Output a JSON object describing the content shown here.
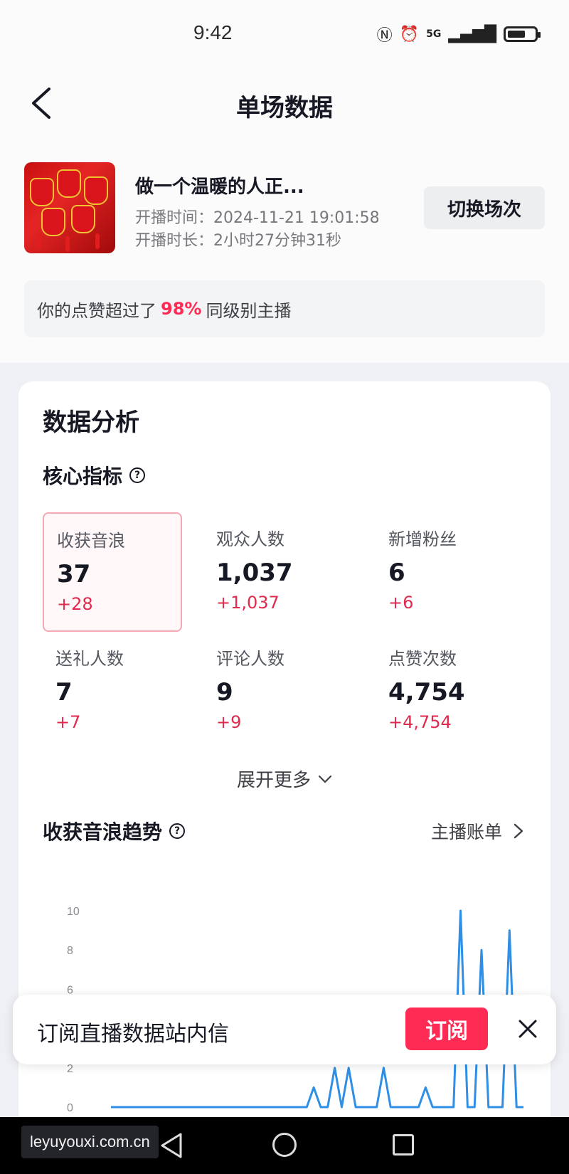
{
  "status_bar": {
    "time": "9:42",
    "network": "5G",
    "icons": [
      "nfc-icon",
      "alarm-icon",
      "signal-icon",
      "battery-icon"
    ]
  },
  "header": {
    "title": "单场数据",
    "back_icon": "chevron-left-icon"
  },
  "session": {
    "title": "做一个温暖的人正...",
    "start_time": "开播时间：2024-11-21 19:01:58",
    "duration": "开播时长：2小时27分钟31秒",
    "switch_label": "切换场次"
  },
  "like_banner": {
    "prefix": "你的点赞超过了",
    "percent": "98%",
    "suffix": "同级别主播"
  },
  "analysis": {
    "title": "数据分析",
    "core_title": "核心指标",
    "metrics": [
      {
        "label": "收获音浪",
        "value": "37",
        "delta": "+28",
        "selected": true
      },
      {
        "label": "观众人数",
        "value": "1,037",
        "delta": "+1,037",
        "selected": false
      },
      {
        "label": "新增粉丝",
        "value": "6",
        "delta": "+6",
        "selected": false
      },
      {
        "label": "送礼人数",
        "value": "7",
        "delta": "+7",
        "selected": false
      },
      {
        "label": "评论人数",
        "value": "9",
        "delta": "+9",
        "selected": false
      },
      {
        "label": "点赞次数",
        "value": "4,754",
        "delta": "+4,754",
        "selected": false
      }
    ],
    "expand_label": "展开更多",
    "trend_title": "收获音浪趋势",
    "host_bill_label": "主播账单"
  },
  "chart_data": {
    "type": "line",
    "title": "",
    "xlabel": "",
    "ylabel": "",
    "ylim": [
      0,
      10
    ],
    "yticks": [
      0,
      2,
      6,
      8,
      10
    ],
    "color": "#2f8fe6",
    "x": [
      0,
      1,
      2,
      3,
      4,
      5,
      6,
      7,
      8,
      9,
      10,
      11,
      12,
      13,
      14,
      15,
      16,
      17,
      18,
      19,
      20,
      21,
      22,
      23,
      24,
      25,
      26,
      27,
      28,
      29,
      30,
      31,
      32,
      33,
      34,
      35,
      36,
      37,
      38,
      39,
      40,
      41,
      42,
      43,
      44,
      45,
      46,
      47,
      48,
      49,
      50,
      51,
      52,
      53,
      54,
      55,
      56,
      57,
      58,
      59
    ],
    "values": [
      0,
      0,
      0,
      0,
      0,
      0,
      0,
      0,
      0,
      0,
      0,
      0,
      0,
      0,
      0,
      0,
      0,
      0,
      0,
      0,
      0,
      0,
      0,
      0,
      0,
      0,
      0,
      0,
      0,
      1,
      0,
      0,
      2,
      0,
      2,
      0,
      0,
      0,
      0,
      2,
      0,
      0,
      0,
      0,
      0,
      1,
      0,
      0,
      0,
      0,
      10,
      0,
      0,
      8,
      0,
      0,
      0,
      9,
      0,
      0
    ]
  },
  "subscribe": {
    "text": "订阅直播数据站内信",
    "button": "订阅"
  },
  "system_nav": {
    "watermark": "leyuyouxi.com.cn"
  },
  "colors": {
    "accent": "#fe2c55",
    "delta": "#e02a4d",
    "chart_line": "#2f8fe6"
  }
}
